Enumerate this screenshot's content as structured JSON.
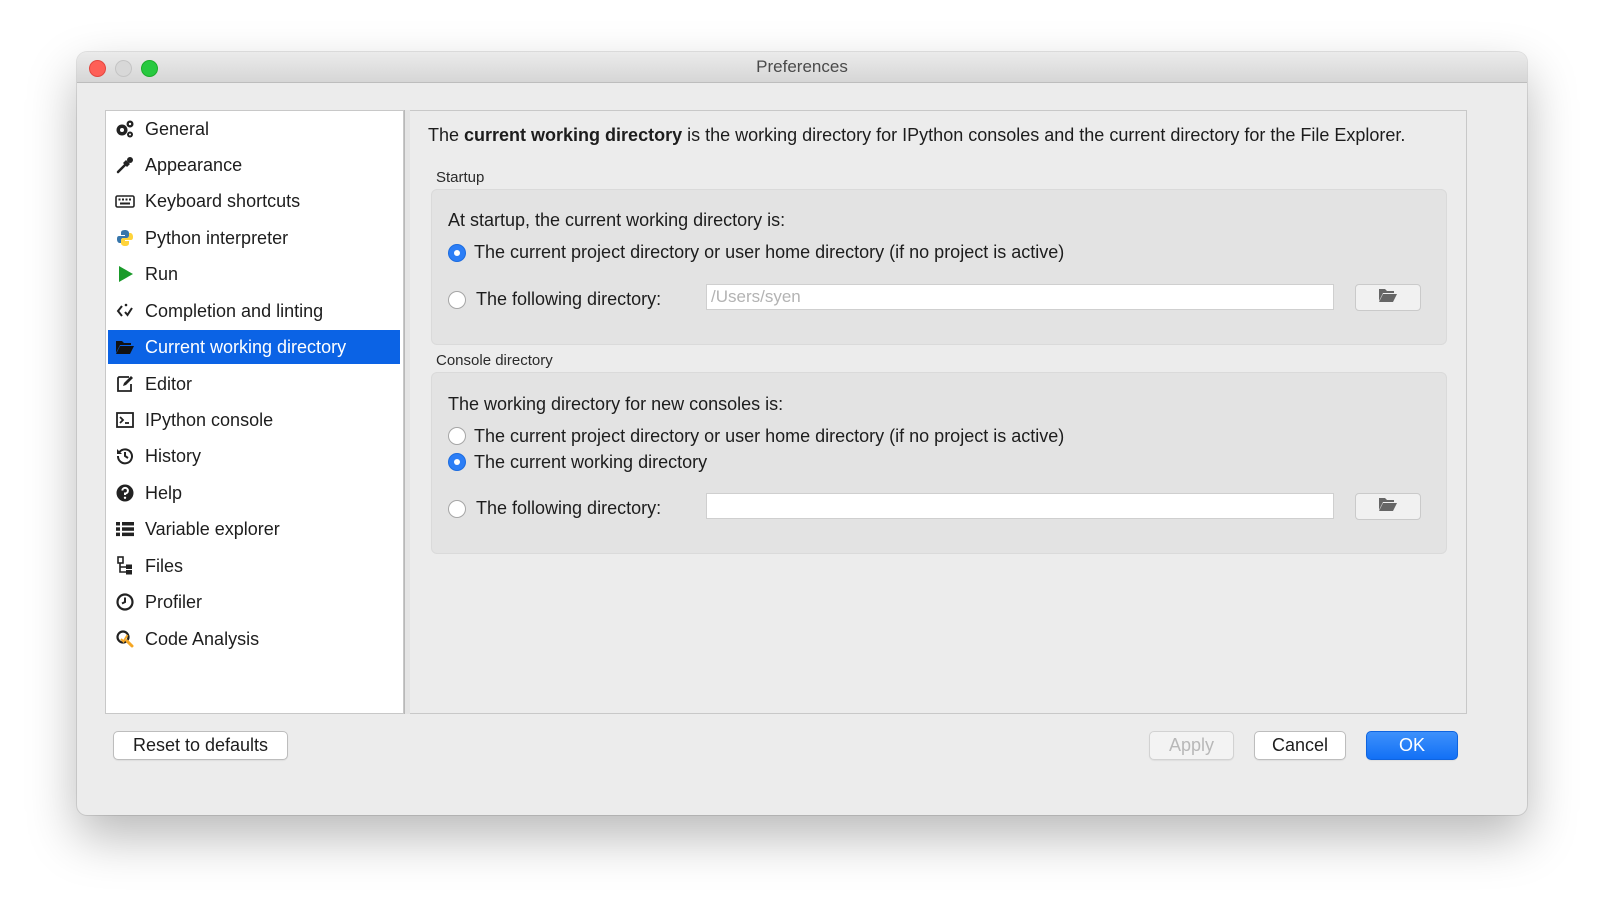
{
  "window": {
    "title": "Preferences"
  },
  "sidebar": {
    "items": [
      {
        "label": "General",
        "icon": "gears-icon"
      },
      {
        "label": "Appearance",
        "icon": "eyedropper-icon"
      },
      {
        "label": "Keyboard shortcuts",
        "icon": "keyboard-icon"
      },
      {
        "label": "Python interpreter",
        "icon": "python-logo-icon"
      },
      {
        "label": "Run",
        "icon": "play-icon"
      },
      {
        "label": "Completion and linting",
        "icon": "code-completion-icon"
      },
      {
        "label": "Current working directory",
        "icon": "folder-open-icon",
        "selected": true
      },
      {
        "label": "Editor",
        "icon": "edit-icon"
      },
      {
        "label": "IPython console",
        "icon": "terminal-icon"
      },
      {
        "label": "History",
        "icon": "history-icon"
      },
      {
        "label": "Help",
        "icon": "help-icon"
      },
      {
        "label": "Variable explorer",
        "icon": "table-list-icon"
      },
      {
        "label": "Files",
        "icon": "files-tree-icon"
      },
      {
        "label": "Profiler",
        "icon": "clock-icon"
      },
      {
        "label": "Code Analysis",
        "icon": "code-analysis-icon"
      }
    ]
  },
  "main": {
    "intro": {
      "prefix": "The ",
      "bold": "current working directory",
      "suffix": " is the working directory for IPython consoles and the current directory for the File Explorer."
    },
    "startup": {
      "group_title": "Startup",
      "label": "At startup, the current working directory is:",
      "option_project": "The current project directory or user home directory (if no project is active)",
      "option_following": "The following directory:",
      "directory_value": "/Users/syen",
      "selected": "project"
    },
    "console": {
      "group_title": "Console directory",
      "label": "The working directory for new consoles is:",
      "option_project": "The current project directory or user home directory (if no project is active)",
      "option_cwd": "The current working directory",
      "option_following": "The following directory:",
      "directory_value": "",
      "selected": "cwd"
    }
  },
  "footer": {
    "reset_label": "Reset to defaults",
    "apply_label": "Apply",
    "cancel_label": "Cancel",
    "ok_label": "OK"
  },
  "colors": {
    "selection": "#0b63e5",
    "radio_on": "#2c7ef6",
    "ok_button": "#1270f5",
    "run_icon": "#1a9a2a",
    "python_blue": "#3776ab",
    "python_yellow": "#ffd43b",
    "analysis_orange": "#f5a623"
  }
}
